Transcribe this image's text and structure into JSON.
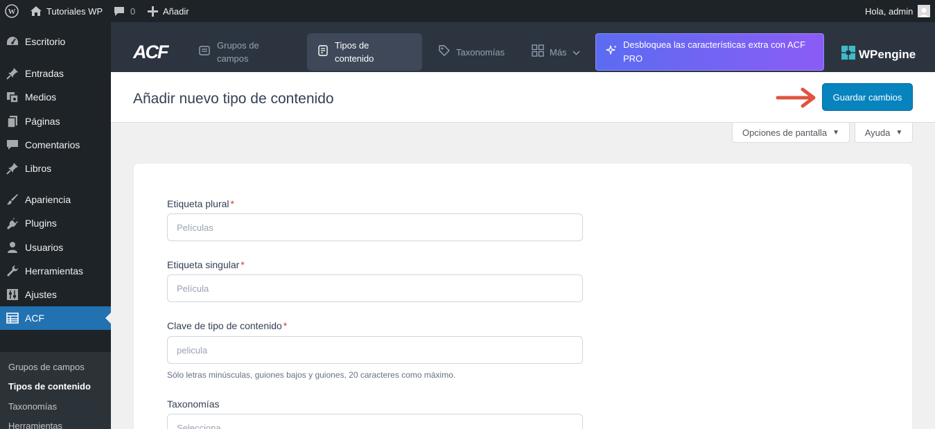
{
  "adminbar": {
    "site_name": "Tutoriales WP",
    "comments_count": "0",
    "add_new": "Añadir",
    "greeting": "Hola, admin"
  },
  "sidebar": {
    "items": [
      {
        "label": "Escritorio",
        "icon": "dashboard-icon"
      },
      {
        "label": "Entradas",
        "icon": "pin-icon"
      },
      {
        "label": "Medios",
        "icon": "media-icon"
      },
      {
        "label": "Páginas",
        "icon": "pages-icon"
      },
      {
        "label": "Comentarios",
        "icon": "comment-icon"
      },
      {
        "label": "Libros",
        "icon": "pin-icon"
      },
      {
        "label": "Apariencia",
        "icon": "brush-icon"
      },
      {
        "label": "Plugins",
        "icon": "plugin-icon"
      },
      {
        "label": "Usuarios",
        "icon": "user-icon"
      },
      {
        "label": "Herramientas",
        "icon": "wrench-icon"
      },
      {
        "label": "Ajustes",
        "icon": "settings-icon"
      },
      {
        "label": "ACF",
        "icon": "table-icon"
      }
    ],
    "submenu": [
      "Grupos de campos",
      "Tipos de contenido",
      "Taxonomías",
      "Herramientas"
    ]
  },
  "acf_header": {
    "logo": "ACF",
    "tabs": {
      "field_groups": "Grupos de\ncampos",
      "post_types": "Tipos de\ncontenido",
      "taxonomies": "Taxonomías",
      "more": "Más"
    },
    "pro_banner": "Desbloquea las características extra con ACF PRO",
    "partner_logo": "WPengine"
  },
  "titlebar": {
    "title": "Añadir nuevo tipo de contenido",
    "save_label": "Guardar cambios"
  },
  "screen_meta": {
    "options_label": "Opciones de pantalla",
    "help_label": "Ayuda"
  },
  "form": {
    "plural_label": "Etiqueta plural",
    "plural_placeholder": "Películas",
    "singular_label": "Etiqueta singular",
    "singular_placeholder": "Película",
    "key_label": "Clave de tipo de contenido",
    "key_placeholder": "pelicula",
    "key_help": "Sólo letras minúsculas, guiones bajos y guiones, 20 caracteres como máximo.",
    "taxonomies_label": "Taxonomías",
    "taxonomies_placeholder": "Selecciona",
    "required_mark": "*"
  },
  "colors": {
    "admin_dark": "#1d2327",
    "acf_header": "#2c3440",
    "primary": "#0783be",
    "arrow": "#e0533f"
  }
}
